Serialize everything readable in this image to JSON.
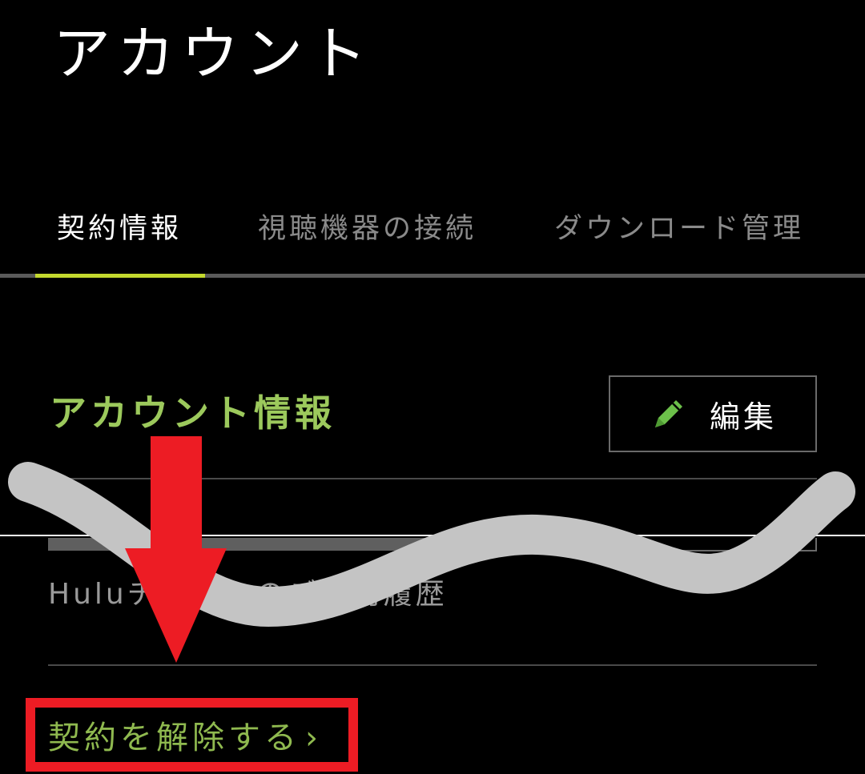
{
  "header": {
    "title": "アカウント"
  },
  "tabs": [
    {
      "label": "契約情報",
      "active": true
    },
    {
      "label": "視聴機器の接続",
      "active": false
    },
    {
      "label": "ダウンロード管理",
      "active": false
    }
  ],
  "account_section": {
    "title": "アカウント情報",
    "edit_label": "編集"
  },
  "history_link": {
    "label": "Huluチケットのご利用履歴"
  },
  "cancel_link": {
    "label": "契約を解除する",
    "chevron": "›"
  },
  "colors": {
    "background": "#000000",
    "accent_tab": "#c4d92e",
    "green_text": "#9cc95c",
    "pencil": "#6cc04a",
    "annotation_red": "#ed1c24",
    "wave_grey": "#c4c4c4"
  },
  "icons": {
    "edit": "pencil-icon",
    "chevron": "chevron-right-icon"
  }
}
